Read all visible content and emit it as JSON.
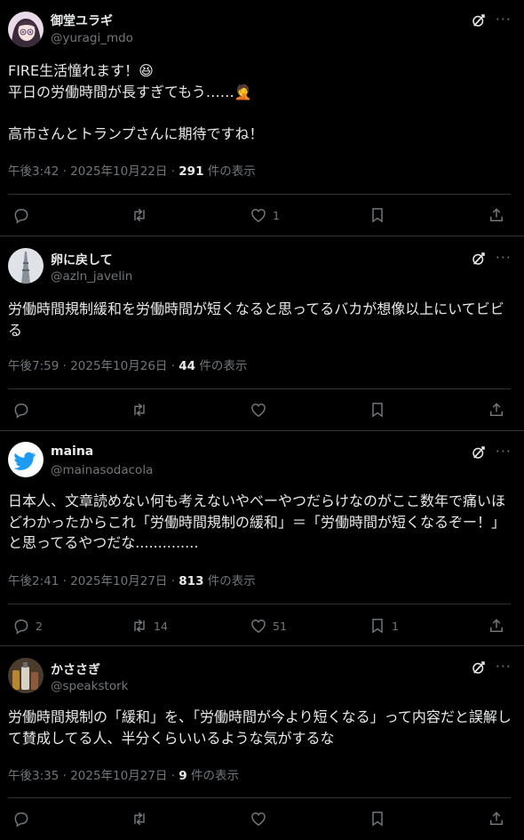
{
  "posts": [
    {
      "name": "御堂ユラギ",
      "handle": "@yuragi_mdo",
      "body": "FIRE生活憧れます！😆\n平日の労働時間が長すぎてもう……🤦\n\n高市さんとトランプさんに期待ですね！",
      "time": "午後3:42 · 2025年10月22日 · ",
      "views": "291",
      "views_suffix": " 件の表示",
      "reply_count": "",
      "repost_count": "",
      "like_count": "1",
      "bookmark_count": ""
    },
    {
      "name": "卵に戻して",
      "handle": "@azln_javelin",
      "body": "労働時間規制緩和を労働時間が短くなると思ってるバカが想像以上にいてビビる",
      "time": "午後7:59 · 2025年10月26日 · ",
      "views": "44",
      "views_suffix": " 件の表示",
      "reply_count": "",
      "repost_count": "",
      "like_count": "",
      "bookmark_count": ""
    },
    {
      "name": "maina",
      "handle": "@mainasodacola",
      "body": "日本人、文章読めない何も考えないやべーやつだらけなのがここ数年で痛いほどわかったからこれ「労働時間規制の緩和」＝「労働時間が短くなるぞー！」と思ってるやつだな..............",
      "time": "午後2:41 · 2025年10月27日 · ",
      "views": "813",
      "views_suffix": " 件の表示",
      "reply_count": "2",
      "repost_count": "14",
      "like_count": "51",
      "bookmark_count": "1"
    },
    {
      "name": "かささぎ",
      "handle": "@speakstork",
      "body": "労働時間規制の「緩和」を、「労働時間が今より短くなる」って内容だと誤解して賛成してる人、半分くらいいるような気がするな",
      "time": "午後3:35 · 2025年10月27日 · ",
      "views": "9",
      "views_suffix": " 件の表示",
      "reply_count": "",
      "repost_count": "",
      "like_count": "",
      "bookmark_count": ""
    }
  ],
  "icons": {
    "more": "···",
    "reply": "reply-icon",
    "repost": "repost-icon",
    "like": "like-icon",
    "bookmark": "bookmark-icon",
    "share": "share-icon",
    "grok": "grok-icon"
  },
  "colors": {
    "background": "#000000",
    "text": "#e7e9ea",
    "muted": "#71767b",
    "divider": "#2f3336",
    "twitter_blue": "#1d9bf0"
  }
}
